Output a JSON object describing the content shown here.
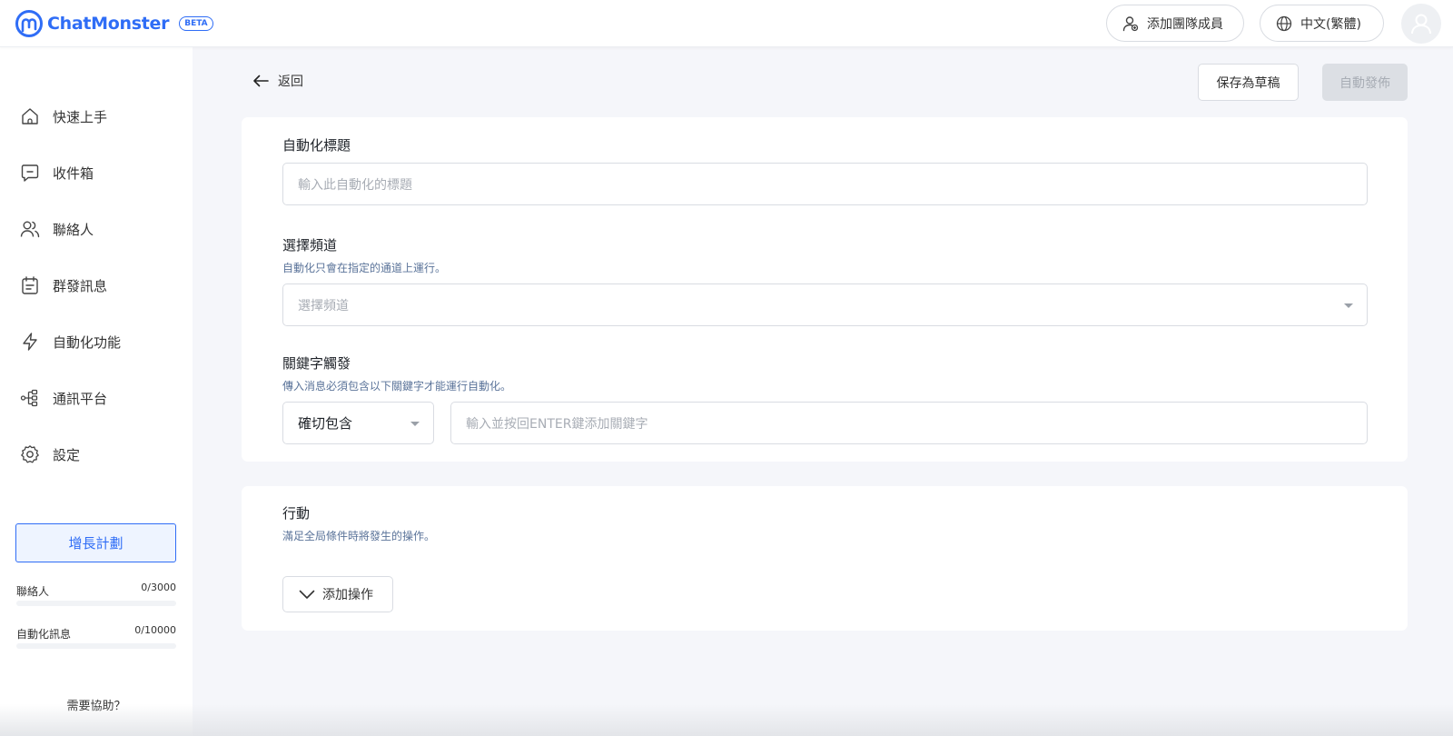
{
  "brand": {
    "name": "ChatMonster",
    "badge": "BETA",
    "color": "#2f6df6"
  },
  "header": {
    "add_member_label": "添加團隊成員",
    "language_label": "中文(繁體)"
  },
  "sidebar": {
    "items": [
      {
        "label": "快速上手",
        "icon": "home-icon"
      },
      {
        "label": "收件箱",
        "icon": "inbox-icon"
      },
      {
        "label": "聯絡人",
        "icon": "contacts-icon"
      },
      {
        "label": "群發訊息",
        "icon": "broadcast-icon"
      },
      {
        "label": "自動化功能",
        "icon": "lightning-icon"
      },
      {
        "label": "通訊平台",
        "icon": "channels-icon"
      },
      {
        "label": "設定",
        "icon": "gear-icon"
      }
    ],
    "growth_plan_label": "增長計劃",
    "usage": [
      {
        "label": "聯絡人",
        "value": "0/3000",
        "fraction": 0
      },
      {
        "label": "自動化訊息",
        "value": "0/10000",
        "fraction": 0
      }
    ],
    "help_label": "需要協助？"
  },
  "toolbar": {
    "back_label": "返回",
    "save_draft_label": "保存為草稿",
    "publish_label": "自動發佈"
  },
  "form": {
    "title": {
      "label": "自動化標題",
      "placeholder": "輸入此自動化的標題"
    },
    "channel": {
      "label": "選擇頻道",
      "help": "自動化只會在指定的通道上運行。",
      "placeholder": "選擇頻道"
    },
    "keyword": {
      "label": "關鍵字觸發",
      "help": "傳入消息必須包含以下關鍵字才能運行自動化。",
      "match_value": "確切包含",
      "placeholder": "輸入並按回ENTER鍵添加關鍵字"
    }
  },
  "actions": {
    "label": "行動",
    "help": "滿足全局條件時將發生的操作。",
    "add_label": "添加操作"
  }
}
